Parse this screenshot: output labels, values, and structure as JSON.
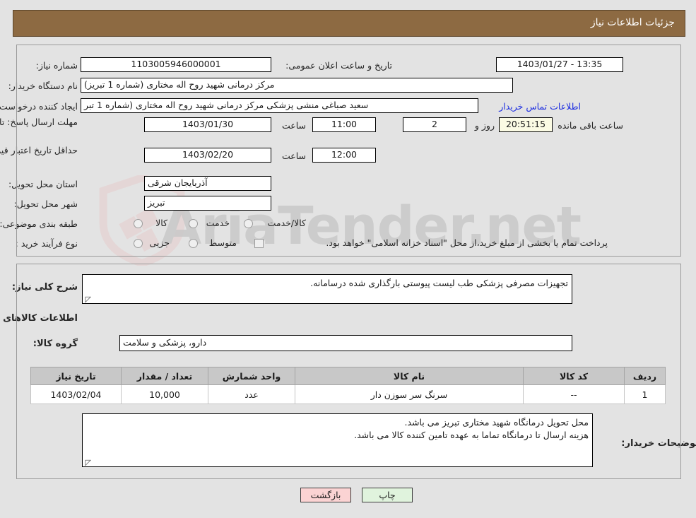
{
  "header": {
    "title": "جزئیات اطلاعات نیاز"
  },
  "watermark": {
    "text": "AriaTender.net",
    "shield_color": "#e8b9b9",
    "text_color": "#c9c9c9"
  },
  "form": {
    "need_number": {
      "label": "شماره نیاز:",
      "value": "1103005946000001"
    },
    "public_announce": {
      "label": "تاریخ و ساعت اعلان عمومی:",
      "value": "13:35 - 1403/01/27"
    },
    "buyer_org": {
      "label": "نام دستگاه خریدار:",
      "value": "مرکز درمانی شهید روح اله مختاری (شماره 1 تبریز)"
    },
    "requester": {
      "label": "ایجاد کننده درخواست:",
      "value": "سعید صباغی منشی  پزشکی مرکز درمانی شهید روح اله مختاری (شماره 1 تبر",
      "contact_link": "اطلاعات تماس خریدار"
    },
    "reply_deadline": {
      "label": "مهلت ارسال پاسخ: تا تاریخ:",
      "date": "1403/01/30",
      "time_label": "ساعت",
      "time": "11:00",
      "days": "2",
      "days_unit_label": "روز و",
      "countdown": "20:51:15",
      "countdown_suffix": "ساعت باقی مانده"
    },
    "price_validity": {
      "label": "حداقل تاریخ اعتبار قیمت: تا تاریخ:",
      "date": "1403/02/20",
      "time_label": "ساعت",
      "time": "12:00"
    },
    "delivery_province": {
      "label": "استان محل تحویل:",
      "value": "آذربایجان شرقی"
    },
    "delivery_city": {
      "label": "شهر محل تحویل:",
      "value": "تبریز"
    },
    "classification": {
      "label": "طبقه بندی موضوعی:",
      "options": [
        "کالا",
        "خدمت",
        "کالا/خدمت"
      ],
      "selected": ""
    },
    "purchase_process": {
      "label": "نوع فرآیند خرید :",
      "options": [
        "جزیی",
        "متوسط"
      ],
      "selected": "",
      "checkbox_note": "پرداخت تمام یا بخشی از مبلغ خرید،از محل \"اسناد خزانه اسلامی\" خواهد بود.",
      "checkbox_checked": false
    }
  },
  "description": {
    "label": "شرح کلی نیاز:",
    "value": "تجهیزات مصرفی پزشکی طب لیست پیوستی بارگذاری شده درسامانه."
  },
  "goods_section": {
    "title": "اطلاعات کالاهای مورد نیاز",
    "group_label": "گروه کالا:",
    "group_value": "دارو، پزشکی و سلامت"
  },
  "table": {
    "columns": [
      "ردیف",
      "کد کالا",
      "نام کالا",
      "واحد شمارش",
      "تعداد / مقدار",
      "تاریخ نیاز"
    ],
    "rows": [
      {
        "row_no": "1",
        "code": "--",
        "name": "سرنگ سر سوزن دار",
        "unit": "عدد",
        "quantity": "10,000",
        "need_date": "1403/02/04"
      }
    ]
  },
  "buyer_notes": {
    "label": "توضیحات خریدار:",
    "line1": "محل تحویل درمانگاه شهید مختاری تبریز می باشد.",
    "line2": "هزینه ارسال تا درمانگاه تماما به عهده تامین کننده کالا می باشد."
  },
  "footer": {
    "back_label": "بازگشت",
    "print_label": "چاپ"
  }
}
